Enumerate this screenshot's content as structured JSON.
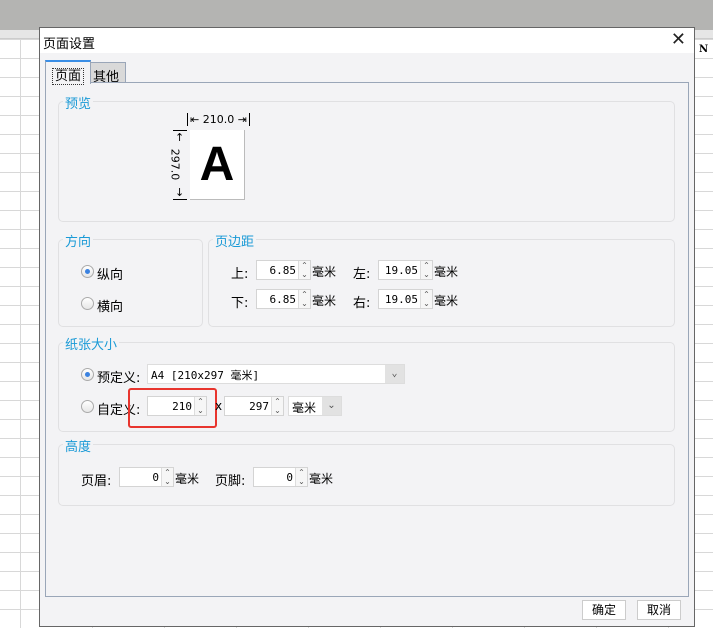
{
  "background": {
    "column_header": "N"
  },
  "dialog": {
    "title": "页面设置",
    "tabs": [
      "页面",
      "其他"
    ]
  },
  "preview": {
    "label": "预览",
    "width": "210.0",
    "height": "297.0",
    "letter": "A"
  },
  "orientation": {
    "label": "方向",
    "options": [
      {
        "label": "纵向",
        "selected": true
      },
      {
        "label": "横向",
        "selected": false
      }
    ]
  },
  "margins": {
    "label": "页边距",
    "top_label": "上:",
    "top": "6.85",
    "bottom_label": "下:",
    "bottom": "6.85",
    "left_label": "左:",
    "left": "19.05",
    "right_label": "右:",
    "right": "19.05",
    "unit": "毫米"
  },
  "paper": {
    "label": "纸张大小",
    "preset_label": "预定义:",
    "preset_value": "A4 [210x297 毫米]",
    "custom_label": "自定义:",
    "custom_width": "210",
    "separator": "x",
    "custom_height": "297",
    "custom_unit": "毫米",
    "preset_selected": true
  },
  "height": {
    "label": "高度",
    "header_label": "页眉:",
    "header": "0",
    "footer_label": "页脚:",
    "footer": "0",
    "unit": "毫米"
  },
  "buttons": {
    "ok": "确定",
    "cancel": "取消"
  },
  "highlight_color": "#e8352e"
}
